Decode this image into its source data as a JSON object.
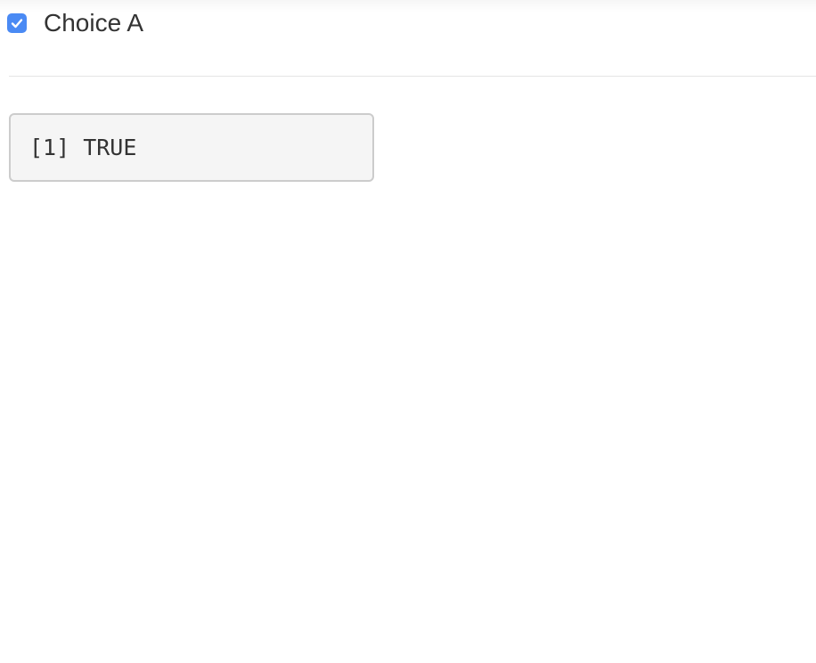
{
  "checkbox": {
    "label": "Choice A",
    "checked": true,
    "icon": "checkmark-icon",
    "accent_color": "#4a8af4"
  },
  "output": {
    "text": "[1] TRUE"
  }
}
